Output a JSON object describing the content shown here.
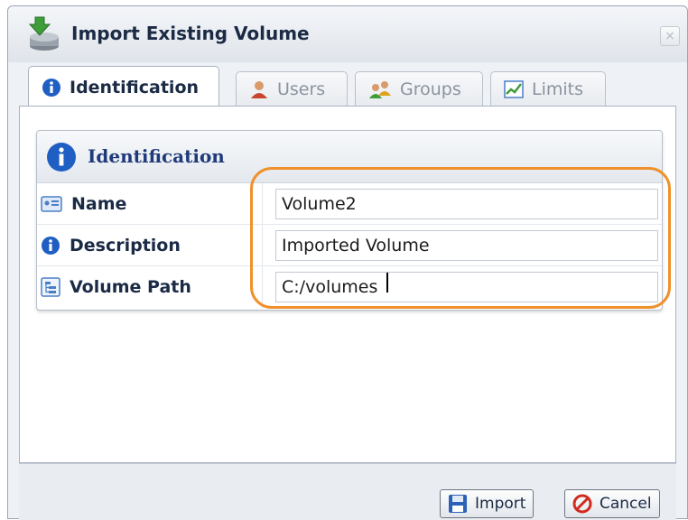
{
  "dialog": {
    "title": "Import Existing Volume",
    "title_icon": "import-volume-icon",
    "close_glyph": "×"
  },
  "tabs": [
    {
      "label": "Identification",
      "icon": "info-icon",
      "active": true
    },
    {
      "label": "Users",
      "icon": "user-icon",
      "active": false
    },
    {
      "label": "Groups",
      "icon": "group-icon",
      "active": false
    },
    {
      "label": "Limits",
      "icon": "chart-icon",
      "active": false
    }
  ],
  "section": {
    "title": "Identification",
    "icon": "info-icon"
  },
  "fields": {
    "name": {
      "label": "Name",
      "value": "Volume2",
      "icon": "id-card-icon"
    },
    "description": {
      "label": "Description",
      "value": "Imported Volume",
      "icon": "info-icon"
    },
    "path": {
      "label": "Volume Path",
      "value": "C:/volumes",
      "icon": "folder-tree-icon"
    }
  },
  "buttons": {
    "import_label": "Import",
    "cancel_label": "Cancel"
  },
  "colors": {
    "accent_highlight": "#f0902a",
    "info_blue": "#1f5fc4",
    "title_text": "#1b2a45"
  }
}
